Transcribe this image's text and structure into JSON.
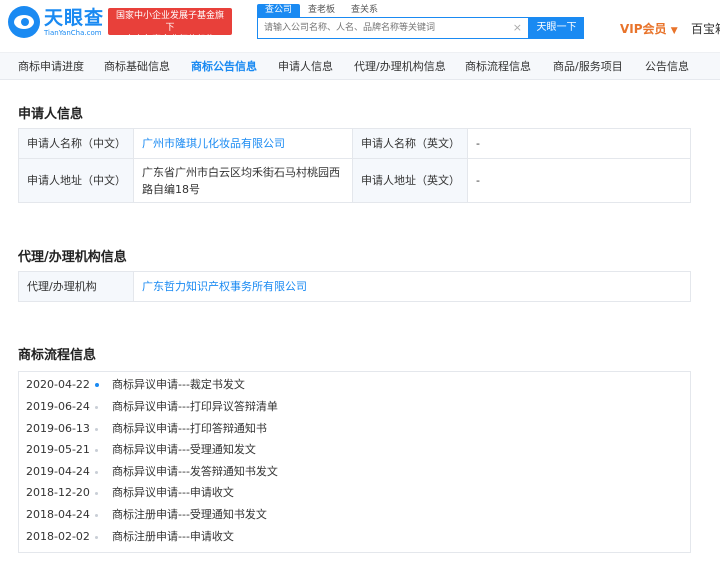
{
  "header": {
    "logo_cn": "天眼查",
    "logo_en": "TianYanCha.com",
    "badge_line1": "国家中小企业发展子基金旗下",
    "badge_line2": "官方备案企业征信机构",
    "search_tabs": [
      "查公司",
      "查老板",
      "查关系"
    ],
    "search_placeholder": "请输入公司名称、人名、品牌名称等关键词",
    "search_button": "天眼一下",
    "vip_label": "VIP会员",
    "baibao_label": "百宝箱"
  },
  "tabs": [
    "商标申请进度",
    "商标基础信息",
    "商标公告信息",
    "申请人信息",
    "代理/办理机构信息",
    "商标流程信息",
    "商品/服务项目",
    "公告信息"
  ],
  "applicant": {
    "title": "申请人信息",
    "name_cn_label": "申请人名称（中文）",
    "name_cn_value": "广州市隆琪儿化妆品有限公司",
    "name_en_label": "申请人名称（英文）",
    "name_en_value": "-",
    "addr_cn_label": "申请人地址（中文）",
    "addr_cn_value": "广东省广州市白云区均禾街石马村桃园西路自编18号",
    "addr_en_label": "申请人地址（英文）",
    "addr_en_value": "-"
  },
  "agency": {
    "title": "代理/办理机构信息",
    "label": "代理/办理机构",
    "value": "广东哲力知识产权事务所有限公司"
  },
  "process": {
    "title": "商标流程信息",
    "items": [
      {
        "date": "2020-04-22",
        "text": "商标异议申请---裁定书发文"
      },
      {
        "date": "2019-06-24",
        "text": "商标异议申请---打印异议答辩清单"
      },
      {
        "date": "2019-06-13",
        "text": "商标异议申请---打印答辩通知书"
      },
      {
        "date": "2019-05-21",
        "text": "商标异议申请---受理通知发文"
      },
      {
        "date": "2019-04-24",
        "text": "商标异议申请---发答辩通知书发文"
      },
      {
        "date": "2018-12-20",
        "text": "商标异议申请---申请收文"
      },
      {
        "date": "2018-04-24",
        "text": "商标注册申请---受理通知书发文"
      },
      {
        "date": "2018-02-02",
        "text": "商标注册申请---申请收文"
      }
    ]
  },
  "colors": {
    "accent": "#1a8af2",
    "badge": "#e8403a",
    "vip": "#e8732a"
  }
}
